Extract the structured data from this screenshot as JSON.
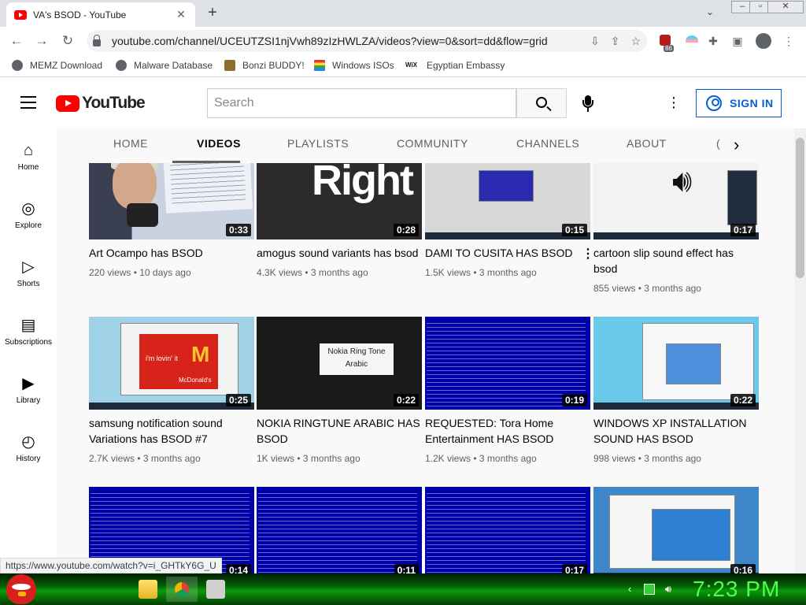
{
  "browser": {
    "tab_title": "VA's BSOD - YouTube",
    "url": "youtube.com/channel/UCEUTZSI1njVwh89zIzHWLZA/videos?view=0&sort=dd&flow=grid",
    "extension_badge_count": "86",
    "status_url": "https://www.youtube.com/watch?v=i_GHTkY6G_U"
  },
  "bookmarks": [
    {
      "label": "MEMZ Download"
    },
    {
      "label": "Malware Database"
    },
    {
      "label": "Bonzi BUDDY!"
    },
    {
      "label": "Windows ISOs"
    },
    {
      "label": "Egyptian Embassy"
    }
  ],
  "youtube": {
    "logo_text": "YouTube",
    "search_placeholder": "Search",
    "sign_in_label": "SIGN IN",
    "sidebar": [
      {
        "label": "Home",
        "icon": "home-icon"
      },
      {
        "label": "Explore",
        "icon": "compass-icon"
      },
      {
        "label": "Shorts",
        "icon": "shorts-icon"
      },
      {
        "label": "Subscriptions",
        "icon": "subscriptions-icon"
      },
      {
        "label": "Library",
        "icon": "library-icon"
      },
      {
        "label": "History",
        "icon": "history-icon"
      }
    ],
    "channel_tabs": [
      {
        "label": "HOME"
      },
      {
        "label": "VIDEOS",
        "active": true
      },
      {
        "label": "PLAYLISTS"
      },
      {
        "label": "COMMUNITY"
      },
      {
        "label": "CHANNELS"
      },
      {
        "label": "ABOUT"
      }
    ],
    "videos": [
      {
        "title": "Art Ocampo has BSOD",
        "views": "220 views",
        "age": "10 days ago",
        "duration": "0:33"
      },
      {
        "title": "amogus sound variants has bsod",
        "views": "4.3K views",
        "age": "3 months ago",
        "duration": "0:28"
      },
      {
        "title": "DAMI TO CUSITA HAS BSOD",
        "views": "1.5K views",
        "age": "3 months ago",
        "duration": "0:15"
      },
      {
        "title": "cartoon slip sound effect has bsod",
        "views": "855 views",
        "age": "3 months ago",
        "duration": "0:17"
      },
      {
        "title": "samsung notification sound Variations has BSOD #7",
        "views": "2.7K views",
        "age": "3 months ago",
        "duration": "0:25"
      },
      {
        "title": "NOKIA RINGTUNE ARABIC HAS BSOD",
        "views": "1K views",
        "age": "3 months ago",
        "duration": "0:22"
      },
      {
        "title": "REQUESTED: Tora Home Entertainment HAS BSOD",
        "views": "1.2K views",
        "age": "3 months ago",
        "duration": "0:19"
      },
      {
        "title": "WINDOWS XP INSTALLATION SOUND HAS BSOD",
        "views": "998 views",
        "age": "3 months ago",
        "duration": "0:22"
      },
      {
        "title": "",
        "views": "",
        "age": "",
        "duration": "0:14"
      },
      {
        "title": "",
        "views": "",
        "age": "",
        "duration": "0:11"
      },
      {
        "title": "",
        "views": "",
        "age": "",
        "duration": "0:17"
      },
      {
        "title": "",
        "views": "",
        "age": "",
        "duration": "0:16"
      }
    ],
    "thumb_texts": {
      "right": "Right",
      "mcd_slogan": "i'm lovin' it",
      "mcd_brand": "McDonald's",
      "nokia_line1": "Nokia Ring Tone",
      "nokia_line2": "Arabic"
    }
  },
  "taskbar": {
    "clock": "7:23 PM"
  },
  "colors": {
    "youtube_red": "#ff0000",
    "sign_in_blue": "#065fd4",
    "bsod_blue": "#0000a8",
    "clock_green": "#4cff4c"
  }
}
